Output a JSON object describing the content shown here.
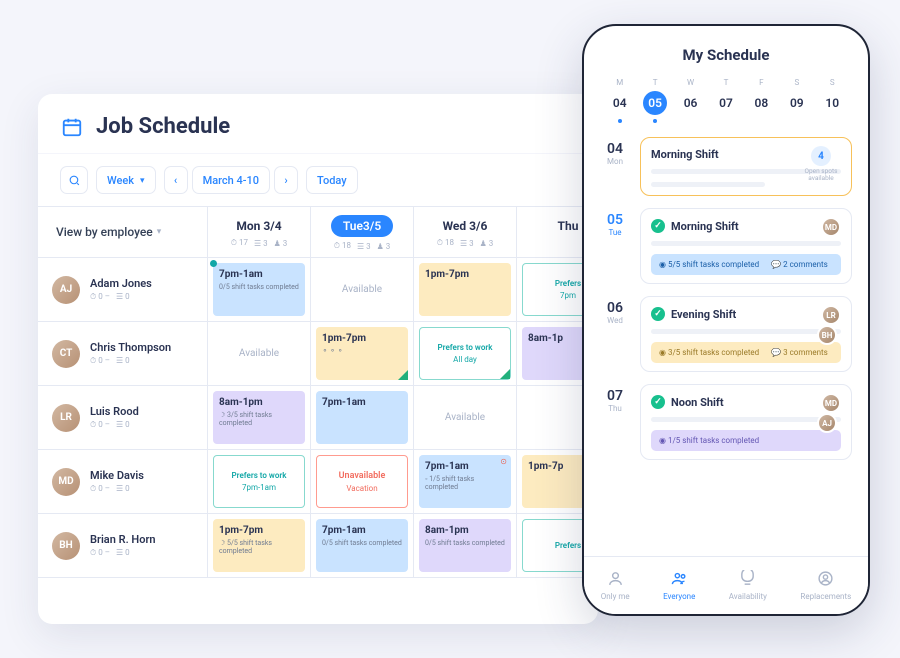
{
  "desktop": {
    "title": "Job Schedule",
    "toolbar": {
      "range_mode": "Week",
      "range_label": "March 4-10",
      "today": "Today"
    },
    "view_by": "View by employee",
    "columns": [
      {
        "label": "Mon 3/4",
        "stats": {
          "hours": "17",
          "jobs": "3",
          "people": "3"
        },
        "active": false
      },
      {
        "label": "Tue3/5",
        "stats": {
          "hours": "18",
          "jobs": "3",
          "people": "3"
        },
        "active": true
      },
      {
        "label": "Wed 3/6",
        "stats": {
          "hours": "18",
          "jobs": "3",
          "people": "3"
        },
        "active": false
      },
      {
        "label": "Thu",
        "stats": {
          "hours": "",
          "jobs": "",
          "people": ""
        },
        "active": false
      }
    ],
    "employees": [
      {
        "name": "Adam Jones",
        "initials": "AJ",
        "stats": [
          "0 –",
          "☰ 0"
        ]
      },
      {
        "name": "Chris Thompson",
        "initials": "CT",
        "stats": [
          "0 –",
          "☰ 0"
        ]
      },
      {
        "name": "Luis Rood",
        "initials": "LR",
        "stats": [
          "0 –",
          "☰ 0"
        ]
      },
      {
        "name": "Mike Davis",
        "initials": "MD",
        "stats": [
          "0 –",
          "☰ 0"
        ]
      },
      {
        "name": "Brian R. Horn",
        "initials": "BH",
        "stats": [
          "0 –",
          "☰ 0"
        ]
      }
    ],
    "cells": [
      [
        {
          "type": "shift",
          "color": "blue",
          "time": "7pm-1am",
          "tasks": "0/5 shift tasks completed",
          "dot": true
        },
        {
          "type": "avail",
          "label": "Available"
        },
        {
          "type": "shift",
          "color": "yellow",
          "time": "1pm-7pm"
        },
        {
          "type": "pref",
          "l1": "Prefers",
          "l2": "7pm"
        }
      ],
      [
        {
          "type": "avail",
          "label": "Available"
        },
        {
          "type": "shift",
          "color": "yellow",
          "time": "1pm-7pm",
          "tasks": "⚬ ⚬ ⚬",
          "tri": true
        },
        {
          "type": "pref",
          "l1": "Prefers to work",
          "l2": "All day",
          "tri": true
        },
        {
          "type": "shift",
          "color": "purple",
          "time": "8am-1p"
        }
      ],
      [
        {
          "type": "shift",
          "color": "purple",
          "time": "8am-1pm",
          "tasks": "☽ 3/5 shift tasks completed"
        },
        {
          "type": "shift",
          "color": "blue",
          "time": "7pm-1am"
        },
        {
          "type": "avail",
          "label": "Available"
        },
        {
          "type": "empty"
        }
      ],
      [
        {
          "type": "pref",
          "l1": "Prefers to work",
          "l2": "7pm-1am"
        },
        {
          "type": "unavail",
          "l1": "Unavailable",
          "l2": "Vacation"
        },
        {
          "type": "shift",
          "color": "blue",
          "time": "7pm-1am",
          "tasks": "◦ 1/5 shift tasks completed",
          "warn": true
        },
        {
          "type": "shift",
          "color": "yellow",
          "time": "1pm-7p"
        }
      ],
      [
        {
          "type": "shift",
          "color": "yellow",
          "time": "1pm-7pm",
          "tasks": "☽ 5/5 shift tasks completed"
        },
        {
          "type": "shift",
          "color": "blue",
          "time": "7pm-1am",
          "tasks": "0/5 shift tasks completed"
        },
        {
          "type": "shift",
          "color": "purple",
          "time": "8am-1pm",
          "tasks": "0/5 shift tasks completed"
        },
        {
          "type": "pref",
          "l1": "Prefers"
        }
      ]
    ]
  },
  "mobile": {
    "title": "My Schedule",
    "weekdays": [
      {
        "d": "M",
        "n": "04",
        "active": false,
        "hasdot": true
      },
      {
        "d": "T",
        "n": "05",
        "active": true,
        "hasdot": true
      },
      {
        "d": "W",
        "n": "06",
        "active": false,
        "hasdot": false
      },
      {
        "d": "T",
        "n": "07",
        "active": false,
        "hasdot": false
      },
      {
        "d": "F",
        "n": "08",
        "active": false,
        "hasdot": false
      },
      {
        "d": "S",
        "n": "09",
        "active": false,
        "hasdot": false
      },
      {
        "d": "S",
        "n": "10",
        "active": false,
        "hasdot": false
      }
    ],
    "days": [
      {
        "num": "04",
        "dow": "Mon",
        "active": false,
        "highlight": true,
        "card": {
          "title": "Morning Shift",
          "right": {
            "type": "badge",
            "num": "4",
            "cap": "Open spots available"
          }
        }
      },
      {
        "num": "05",
        "dow": "Tue",
        "active": true,
        "card": {
          "title": "Morning Shift",
          "tick": true,
          "right": {
            "type": "avatars",
            "list": [
              "MD"
            ]
          },
          "bar": {
            "color": "blue",
            "left": "5/5 shift tasks completed",
            "right": "2 comments"
          }
        }
      },
      {
        "num": "06",
        "dow": "Wed",
        "active": false,
        "card": {
          "title": "Evening Shift",
          "tick": true,
          "right": {
            "type": "avatars",
            "list": [
              "LR",
              "BH"
            ]
          },
          "bar": {
            "color": "yellow",
            "left": "3/5 shift tasks completed",
            "right": "3 comments"
          }
        }
      },
      {
        "num": "07",
        "dow": "Thu",
        "active": false,
        "card": {
          "title": "Noon Shift",
          "tick": true,
          "right": {
            "type": "avatars",
            "list": [
              "MD",
              "AJ"
            ]
          },
          "bar": {
            "color": "purple",
            "left": "1/5 shift tasks completed"
          }
        }
      }
    ],
    "nav": [
      {
        "id": "only-me",
        "label": "Only me",
        "active": false
      },
      {
        "id": "everyone",
        "label": "Everyone",
        "active": true
      },
      {
        "id": "availability",
        "label": "Availability",
        "active": false
      },
      {
        "id": "replacements",
        "label": "Replacements",
        "active": false
      }
    ]
  }
}
